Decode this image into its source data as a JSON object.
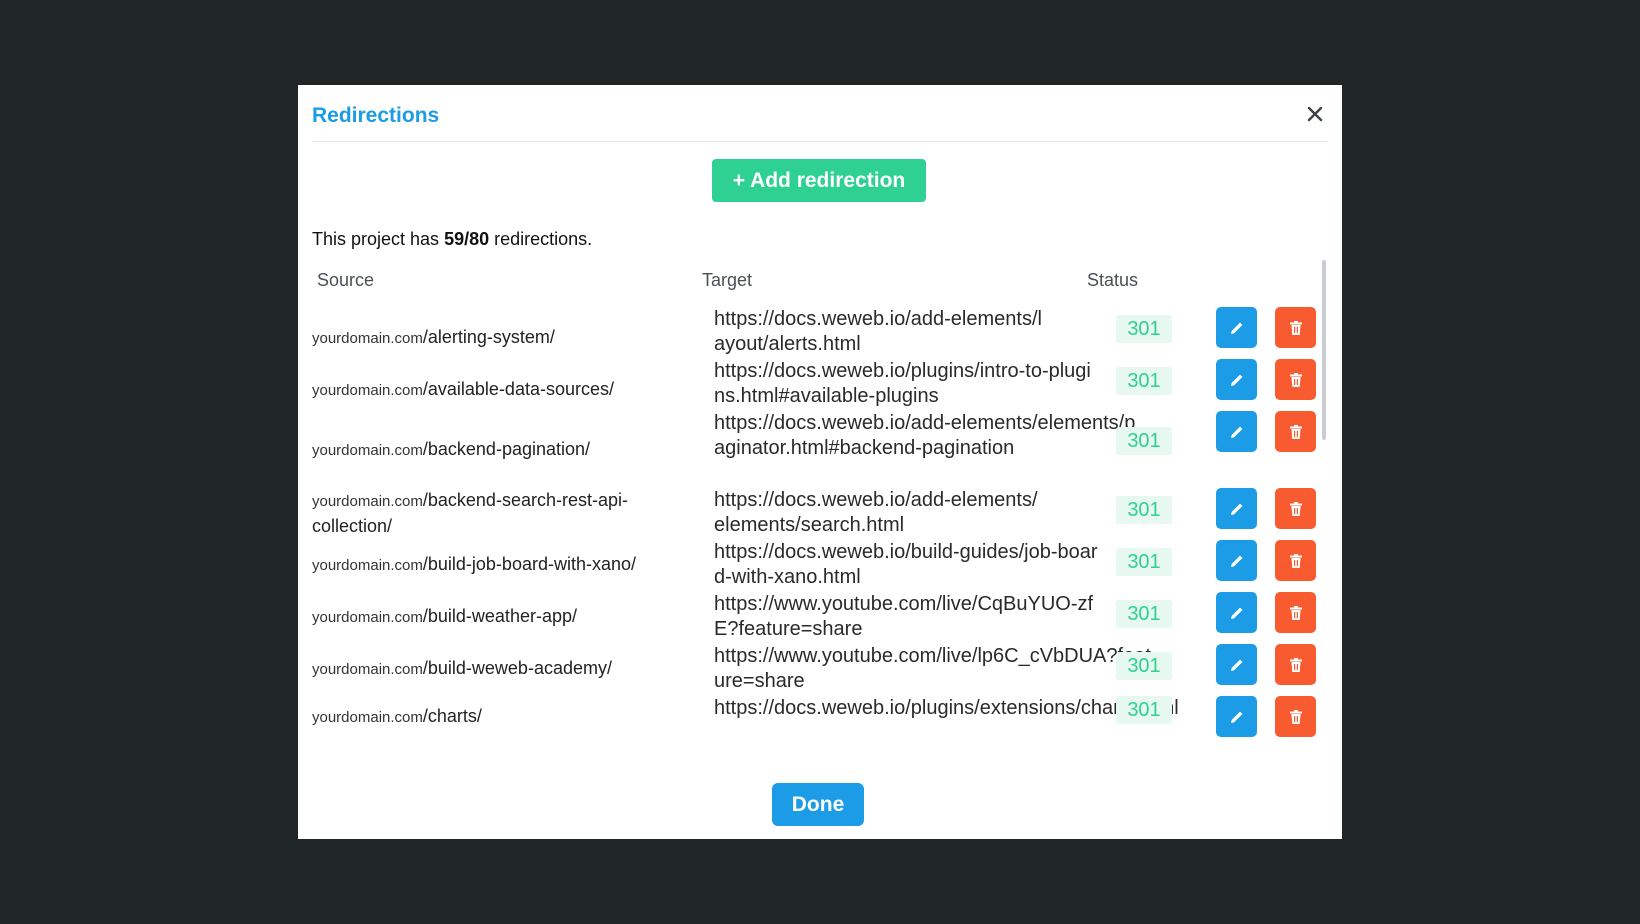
{
  "dialog": {
    "title": "Redirections",
    "add_label": "+ Add redirection",
    "summary_prefix": "This project has ",
    "summary_count": "59/80",
    "summary_suffix": " redirections.",
    "done_label": "Done"
  },
  "table": {
    "headers": {
      "source": "Source",
      "target": "Target",
      "status": "Status"
    },
    "rows": [
      {
        "domain": "yourdomain.com",
        "path": "/alerting-system/",
        "target": "https://docs.weweb.io/add-elements/layout/alerts.html",
        "status": "301"
      },
      {
        "domain": "yourdomain.com",
        "path": "/available-data-sources/",
        "target": "https://docs.weweb.io/plugins/intro-to-plugins.html#available-plugins",
        "status": "301"
      },
      {
        "domain": "yourdomain.com",
        "path": "/backend-pagination/",
        "target": "https://docs.weweb.io/add-elements/elements/paginator.html#backend-pagination",
        "status": "301"
      },
      {
        "domain": "yourdomain.com",
        "path": "/backend-search-rest-api-collection/",
        "target": "https://docs.weweb.io/add-elements/elements/search.html",
        "status": "301"
      },
      {
        "domain": "yourdomain.com",
        "path": "/build-job-board-with-xano/",
        "target": "https://docs.weweb.io/build-guides/job-board-with-xano.html",
        "status": "301"
      },
      {
        "domain": "yourdomain.com",
        "path": "/build-weather-app/",
        "target": "https://www.youtube.com/live/CqBuYUO-zfE?feature=share",
        "status": "301"
      },
      {
        "domain": "yourdomain.com",
        "path": "/build-weweb-academy/",
        "target": "https://www.youtube.com/live/lp6C_cVbDUA?feature=share",
        "status": "301"
      },
      {
        "domain": "yourdomain.com",
        "path": "/charts/",
        "target": "https://docs.weweb.io/plugins/extensions/charts.html",
        "status": "301"
      }
    ]
  },
  "icons": {
    "close": "close-icon",
    "edit": "pencil-icon",
    "delete": "trash-icon"
  },
  "colors": {
    "accent": "#1c9be6",
    "success": "#2ed191",
    "danger": "#f85b30"
  }
}
